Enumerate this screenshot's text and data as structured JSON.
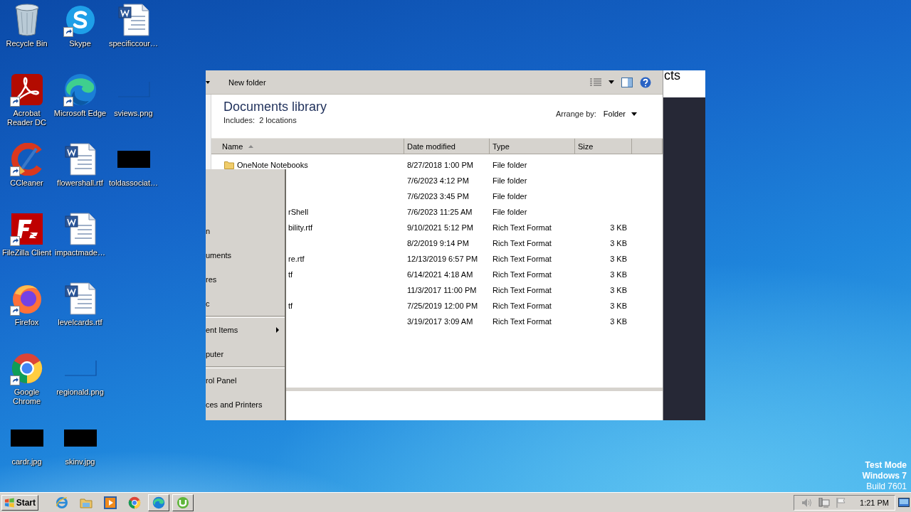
{
  "desktop_icons": [
    {
      "label": "Recycle Bin",
      "kind": "recycle",
      "shortcut": false
    },
    {
      "label": "Acrobat Reader DC",
      "kind": "acrobat",
      "shortcut": true
    },
    {
      "label": "CCleaner",
      "kind": "ccleaner",
      "shortcut": true
    },
    {
      "label": "FileZilla Client",
      "kind": "filezilla",
      "shortcut": true
    },
    {
      "label": "Firefox",
      "kind": "firefox",
      "shortcut": true
    },
    {
      "label": "Google Chrome",
      "kind": "chrome",
      "shortcut": true
    },
    {
      "label": "cardr.jpg",
      "kind": "image-dark",
      "shortcut": false
    },
    {
      "label": "Skype",
      "kind": "skype",
      "shortcut": true
    },
    {
      "label": "Microsoft Edge",
      "kind": "edge",
      "shortcut": true
    },
    {
      "label": "flowershall.rtf",
      "kind": "word",
      "shortcut": false
    },
    {
      "label": "impactmade…",
      "kind": "word",
      "shortcut": false
    },
    {
      "label": "levelcards.rtf",
      "kind": "word",
      "shortcut": false
    },
    {
      "label": "regionald.png",
      "kind": "image-blank",
      "shortcut": false
    },
    {
      "label": "skinv.jpg",
      "kind": "image-dark",
      "shortcut": false
    },
    {
      "label": "specificcour…",
      "kind": "word",
      "shortcut": false
    },
    {
      "label": "sviews.png",
      "kind": "image-blank",
      "shortcut": false
    },
    {
      "label": "toldassociat…",
      "kind": "image-dark",
      "shortcut": false
    }
  ],
  "back_window": {
    "title_fragment": "cts"
  },
  "explorer": {
    "toolbar": {
      "new_folder": "New folder"
    },
    "library_title": "Documents library",
    "includes": "Includes:  2 locations",
    "arrange_label": "Arrange by:",
    "arrange_value": "Folder",
    "columns": [
      {
        "label": "Name",
        "sorted": true
      },
      {
        "label": "Date modified",
        "sorted": false
      },
      {
        "label": "Type",
        "sorted": false
      },
      {
        "label": "Size",
        "sorted": false
      }
    ],
    "rows": [
      {
        "name": "OneNote Notebooks",
        "date": "8/27/2018 1:00 PM",
        "type": "File folder"
      },
      {
        "date": "7/6/2023 4:12 PM",
        "type": "File folder"
      },
      {
        "date": "7/6/2023 3:45 PM",
        "type": "File folder"
      },
      {
        "name": "rShell",
        "date": "7/6/2023 11:25 AM",
        "type": "File folder"
      },
      {
        "name": "bility.rtf",
        "date": "9/10/2021 5:12 PM",
        "type": "Rich Text Format",
        "size": "3 KB"
      },
      {
        "date": "8/2/2019 9:14 PM",
        "type": "Rich Text Format",
        "size": "3 KB"
      },
      {
        "name": "re.rtf",
        "date": "12/13/2019 6:57 PM",
        "type": "Rich Text Format",
        "size": "3 KB"
      },
      {
        "name": "tf",
        "date": "6/14/2021 4:18 AM",
        "type": "Rich Text Format",
        "size": "3 KB"
      },
      {
        "date": "11/3/2017 11:00 PM",
        "type": "Rich Text Format",
        "size": "3 KB"
      },
      {
        "name": "tf",
        "date": "7/25/2019 12:00 PM",
        "type": "Rich Text Format",
        "size": "3 KB"
      },
      {
        "date": "3/19/2017 3:09 AM",
        "type": "Rich Text Format",
        "size": "3 KB"
      }
    ]
  },
  "menu_panel": {
    "items": [
      {
        "label": "n",
        "separator_before": false,
        "submenu": false
      },
      {
        "label": "uments",
        "separator_before": false,
        "submenu": false
      },
      {
        "label": "res",
        "separator_before": false,
        "submenu": false
      },
      {
        "label": "c",
        "separator_before": false,
        "submenu": false
      },
      {
        "label": "ent Items",
        "separator_before": true,
        "submenu": true
      },
      {
        "label": "puter",
        "separator_before": false,
        "submenu": false
      },
      {
        "label": "rol Panel",
        "separator_before": true,
        "submenu": false
      },
      {
        "label": "ces and Printers",
        "separator_before": false,
        "submenu": false
      }
    ]
  },
  "system_notice": [
    "Test Mode",
    "Windows 7",
    "Build 7601"
  ],
  "taskbar": {
    "start": "Start",
    "apps": [
      {
        "kind": "ie",
        "open": false
      },
      {
        "kind": "folder",
        "open": false
      },
      {
        "kind": "media",
        "open": false
      },
      {
        "kind": "chrome",
        "open": false
      },
      {
        "kind": "edge",
        "open": true
      },
      {
        "kind": "utorrent",
        "open": true
      }
    ],
    "clock": "1:21 PM"
  }
}
